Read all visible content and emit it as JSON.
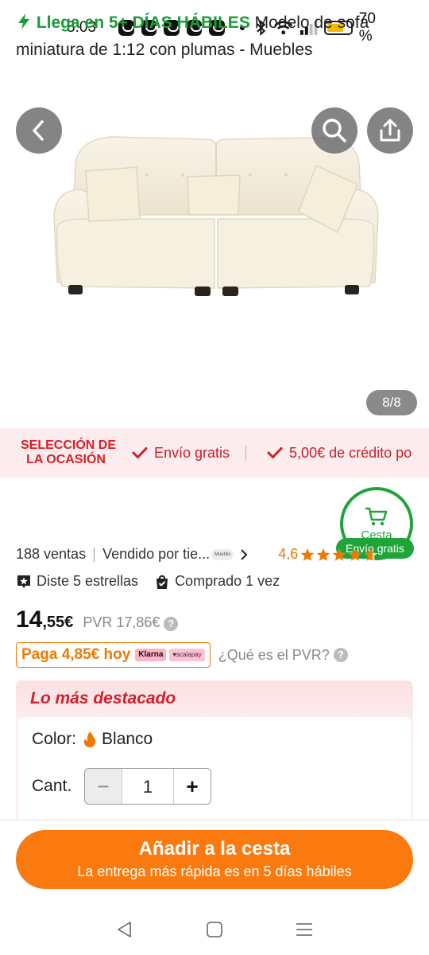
{
  "status_bar": {
    "time": "8:03",
    "battery": "70 %",
    "battery_level": 0.7
  },
  "gallery": {
    "counter": "8/8"
  },
  "banner": {
    "logo_line1": "SELECCIÓN DE",
    "logo_line2": "LA OCASIÓN",
    "items": [
      "Envío gratis",
      "5,00€ de crédito po"
    ]
  },
  "product": {
    "delivery_tag": "Llega en 5+ DÍAS HÁBILES",
    "title": "Modelo de sofá miniatura de 1:12 con plumas - Muebles",
    "sales": "188 ventas",
    "seller": "Vendido por tie...",
    "seller_logo": "Mueblis",
    "rating": "4,6",
    "rating_stars": 4.6,
    "badge_stars": "Diste 5 estrellas",
    "badge_bought": "Comprado 1 vez",
    "price_int": "14",
    "price_dec": ",55€",
    "pvr": "PVR 17,86€",
    "pay_today": "Paga 4,85€ hoy",
    "klarna": "Klarna",
    "scalapay": "♥scalapay",
    "pvr_question": "¿Qué es el PVR?"
  },
  "cart_float": {
    "label": "Cesta",
    "free": "Envío gratis"
  },
  "highlights": {
    "title": "Lo más destacado",
    "color_label": "Color:",
    "color_value": "Blanco",
    "qty_label": "Cant.",
    "qty_value": "1",
    "minus": "−",
    "plus": "+"
  },
  "action": {
    "main": "Añadir a la cesta",
    "sub": "La entrega más rápida es en 5 días hábiles"
  },
  "colors": {
    "brand_orange": "#fa7a10",
    "green": "#1fa43a",
    "red": "#d0202c"
  }
}
